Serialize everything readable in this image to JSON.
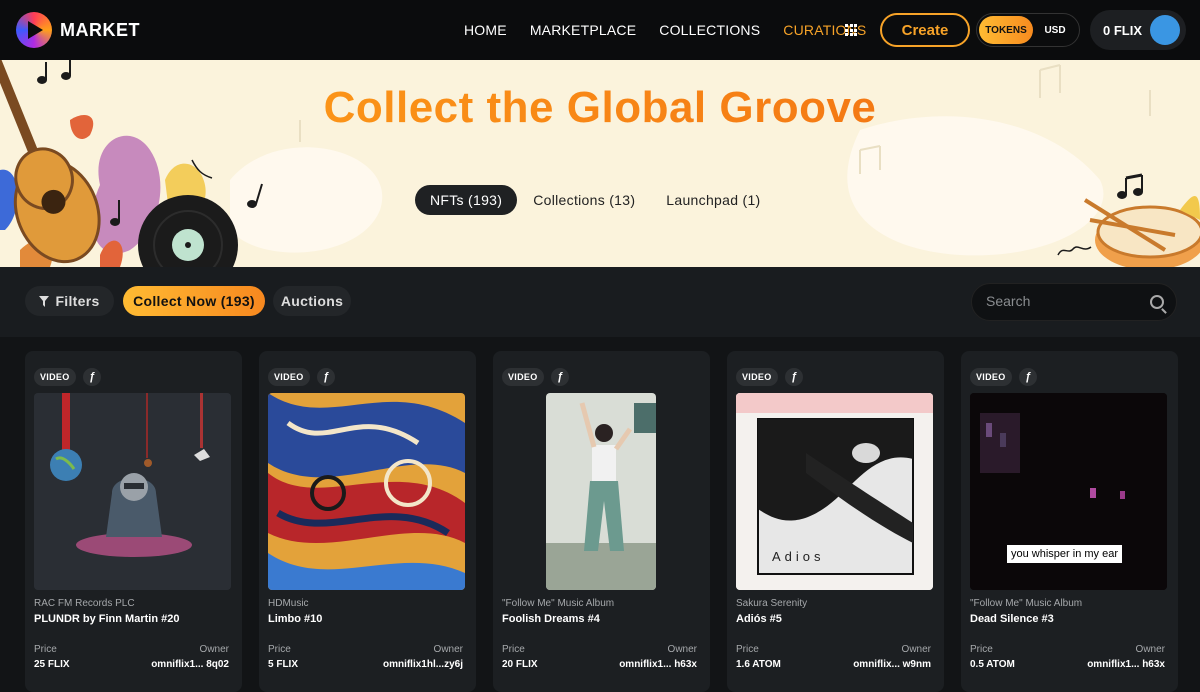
{
  "app": {
    "brand": "MARKET"
  },
  "nav": {
    "links": [
      "HOME",
      "MARKETPLACE",
      "COLLECTIONS",
      "CURATIONS"
    ],
    "active": "CURATIONS",
    "create_label": "Create",
    "toggle": {
      "tokens": "TOKENS",
      "usd": "USD",
      "selected": "TOKENS"
    },
    "wallet_balance": "0 FLIX"
  },
  "banner": {
    "title": "Collect the Global Groove",
    "tabs": [
      "NFTs (193)",
      "Collections (13)",
      "Launchpad (1)"
    ],
    "active_tab": "NFTs (193)"
  },
  "filters": {
    "filters_label": "Filters",
    "collect_now_label": "Collect Now (193)",
    "auctions_label": "Auctions",
    "search_placeholder": "Search"
  },
  "colors": {
    "accent": "#f7a328",
    "background": "#121416",
    "card": "#1c1f22"
  },
  "cards": [
    {
      "badge": "VIDEO",
      "chain_icon": "omniflix-chain-icon",
      "collection": "RAC FM Records PLC",
      "name": "PLUNDR by Finn Martin #20",
      "price_label": "Price",
      "price": "25 FLIX",
      "owner_label": "Owner",
      "owner": "omniflix1... 8q02"
    },
    {
      "badge": "VIDEO",
      "chain_icon": "omniflix-chain-icon",
      "collection": "HDMusic",
      "name": "Limbo #10",
      "price_label": "Price",
      "price": "5 FLIX",
      "owner_label": "Owner",
      "owner": "omniflix1hl...zy6j"
    },
    {
      "badge": "VIDEO",
      "chain_icon": "omniflix-chain-icon",
      "collection": "\"Follow Me\" Music Album",
      "name": "Foolish Dreams #4",
      "price_label": "Price",
      "price": "20 FLIX",
      "owner_label": "Owner",
      "owner": "omniflix1... h63x"
    },
    {
      "badge": "VIDEO",
      "chain_icon": "omniflix-chain-icon",
      "collection": "Sakura Serenity",
      "name": "Adiós #5",
      "price_label": "Price",
      "price": "1.6 ATOM",
      "owner_label": "Owner",
      "owner": "omniflix... w9nm",
      "media_text": "Adios"
    },
    {
      "badge": "VIDEO",
      "chain_icon": "omniflix-chain-icon",
      "collection": "\"Follow Me\" Music Album",
      "name": "Dead Silence #3",
      "price_label": "Price",
      "price": "0.5 ATOM",
      "owner_label": "Owner",
      "owner": "omniflix1... h63x",
      "media_text": "you whisper in my ear"
    }
  ]
}
